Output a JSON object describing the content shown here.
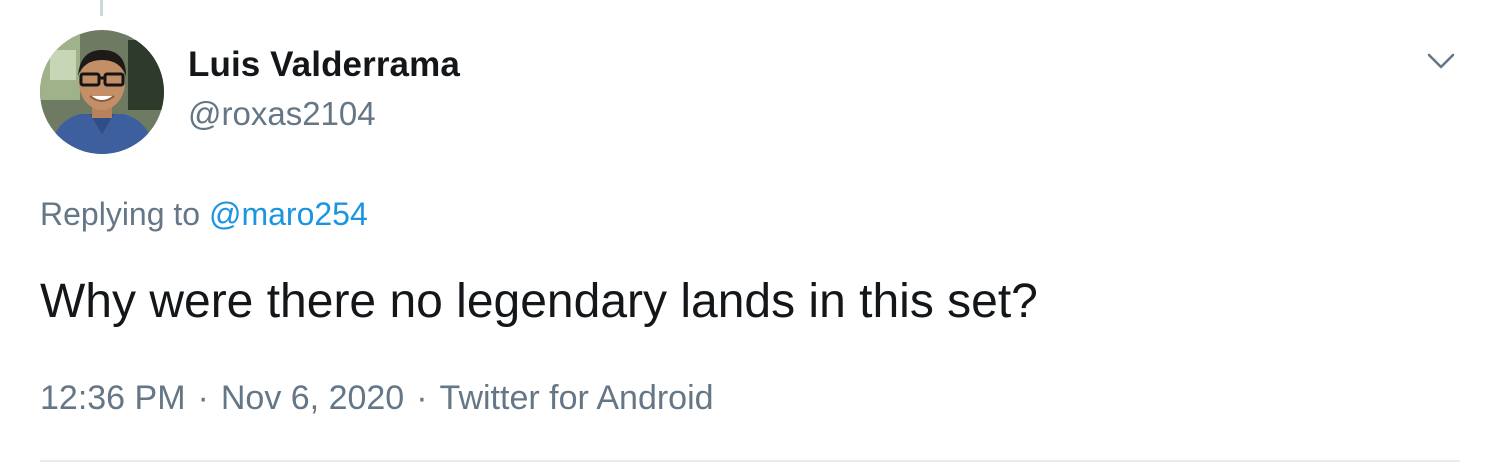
{
  "author": {
    "display_name": "Luis Valderrama",
    "handle": "@roxas2104"
  },
  "reply": {
    "prefix": "Replying to",
    "to_handle": "@maro254"
  },
  "tweet": {
    "text": "Why were there no legendary lands in this set?"
  },
  "meta": {
    "time": "12:36 PM",
    "separator": "·",
    "date": "Nov 6, 2020",
    "source": "Twitter for Android"
  },
  "icons": {
    "caret": "chevron-down-icon",
    "avatar": "profile-photo"
  },
  "colors": {
    "text_primary": "#14171a",
    "text_secondary": "#657786",
    "link": "#1b95e0",
    "divider": "#e6ecf0"
  }
}
